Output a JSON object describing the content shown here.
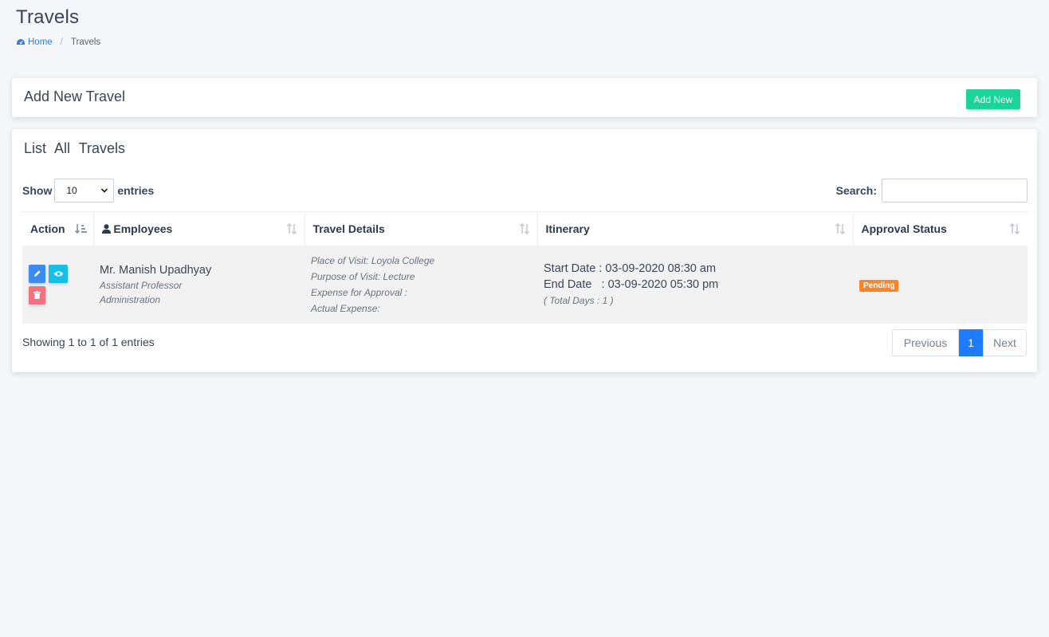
{
  "page": {
    "title": "Travels"
  },
  "breadcrumb": {
    "home": "Home",
    "current": "Travels"
  },
  "add_card": {
    "title": "Add New Travel",
    "button": "Add New"
  },
  "list_card": {
    "title": "List All Travels",
    "show_label": "Show",
    "entries_value": "10",
    "entries_label": "entries",
    "search_label": "Search:",
    "search_value": ""
  },
  "table": {
    "columns": [
      "Action",
      "Employees",
      "Travel Details",
      "Itinerary",
      "Approval Status"
    ],
    "rows": [
      {
        "employee_name": "Mr. Manish Upadhyay",
        "designation": "Assistant Professor",
        "department": "Administration",
        "place": "Place of Visit: Loyola College",
        "purpose": "Purpose of Visit: Lecture",
        "expense_approval": "Expense for Approval :",
        "actual_expense": "Actual Expense:",
        "start_date": "Start Date : 03-09-2020 08:30 am",
        "end_date": "End Date   : 03-09-2020 05:30 pm",
        "total_days": "( Total Days : 1 )",
        "status": "Pending"
      }
    ]
  },
  "footer": {
    "info": "Showing 1 to 1 of 1 entries",
    "previous": "Previous",
    "page": "1",
    "next": "Next"
  },
  "colors": {
    "add_button": "#1bd49a",
    "edit": "#3b8cf0",
    "view": "#17bfe6",
    "delete": "#f6717f",
    "pending": "#f9862b",
    "active_page": "#1f7bff"
  },
  "icons": [
    "dashboard-icon",
    "user-icon",
    "sort-icon",
    "pencil-icon",
    "eye-icon",
    "trash-icon",
    "chevron-down-icon"
  ]
}
